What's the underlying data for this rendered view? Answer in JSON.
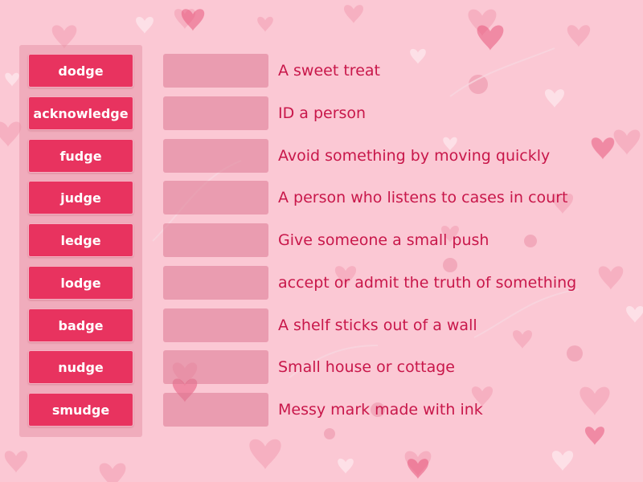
{
  "theme": {
    "background": "#fbc8d4",
    "tile_color": "#e8335f",
    "text_color": "#c8174a",
    "slot_color": "#dc7891"
  },
  "words": [
    {
      "label": "dodge"
    },
    {
      "label": "acknowledge"
    },
    {
      "label": "fudge"
    },
    {
      "label": "judge"
    },
    {
      "label": "ledge"
    },
    {
      "label": "lodge"
    },
    {
      "label": "badge"
    },
    {
      "label": "nudge"
    },
    {
      "label": "smudge"
    }
  ],
  "definitions": [
    {
      "text": "A sweet treat"
    },
    {
      "text": "ID a person"
    },
    {
      "text": "Avoid something by moving quickly"
    },
    {
      "text": "A person who listens to cases in court"
    },
    {
      "text": "Give someone a small push"
    },
    {
      "text": "accept or admit the truth of something"
    },
    {
      "text": "A shelf sticks out of a wall"
    },
    {
      "text": "Small house or cottage"
    },
    {
      "text": "Messy mark made with ink"
    }
  ]
}
